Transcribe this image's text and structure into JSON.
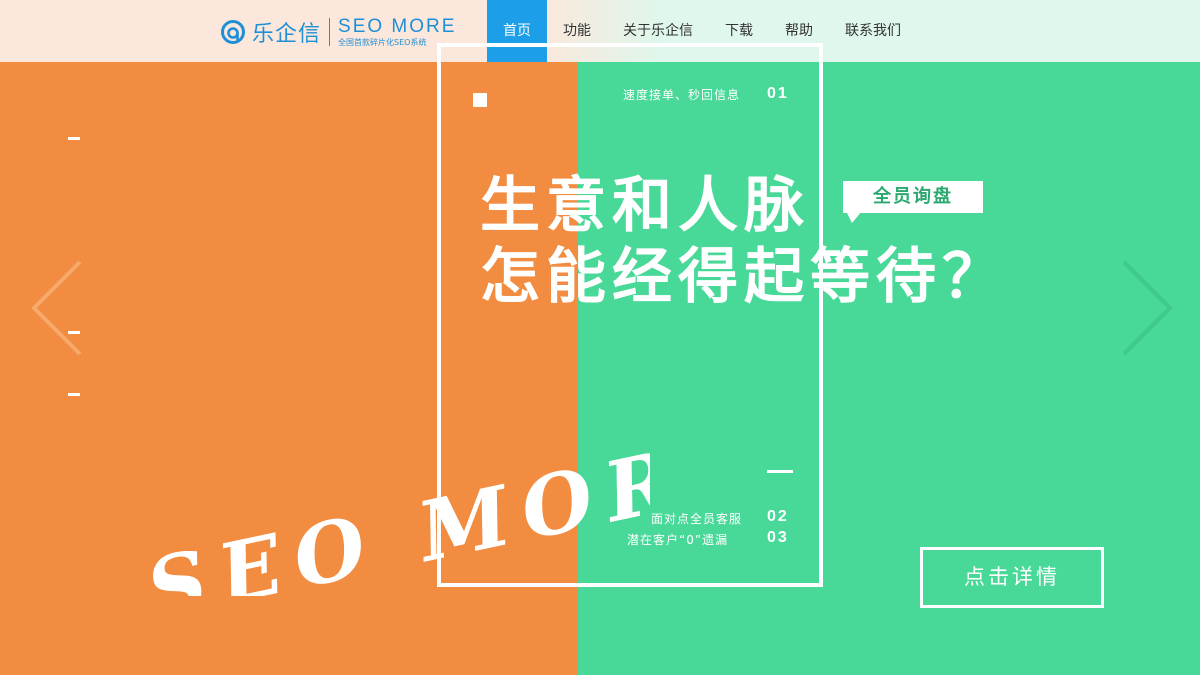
{
  "brand": {
    "name": "乐企信",
    "en_title": "SEO MORE",
    "en_subtitle": "全国首款碎片化SEO系统",
    "logo_icon": "spiral-logo-icon",
    "color": "#1f8fd6"
  },
  "nav": {
    "items": [
      {
        "label": "首页",
        "active": true
      },
      {
        "label": "功能",
        "active": false
      },
      {
        "label": "关于乐企信",
        "active": false
      },
      {
        "label": "下载",
        "active": false
      },
      {
        "label": "帮助",
        "active": false
      },
      {
        "label": "联系我们",
        "active": false
      }
    ],
    "active_color": "#1d9ee8"
  },
  "banner": {
    "left_color": "#f28c40",
    "right_color": "#48d898",
    "features": [
      {
        "text": "速度接单、秒回信息",
        "num": "01"
      },
      {
        "text": "面对点全员客服",
        "num": "02"
      },
      {
        "text": "潜在客户“0”遗漏",
        "num": "03"
      }
    ],
    "headline": [
      "生意和人脉",
      "怎能经得起等待？"
    ],
    "badge": "全员询盘",
    "script_text": "SEO MORE",
    "cta": "点击详情",
    "prev_icon": "chevron-left-icon",
    "next_icon": "chevron-right-icon"
  }
}
